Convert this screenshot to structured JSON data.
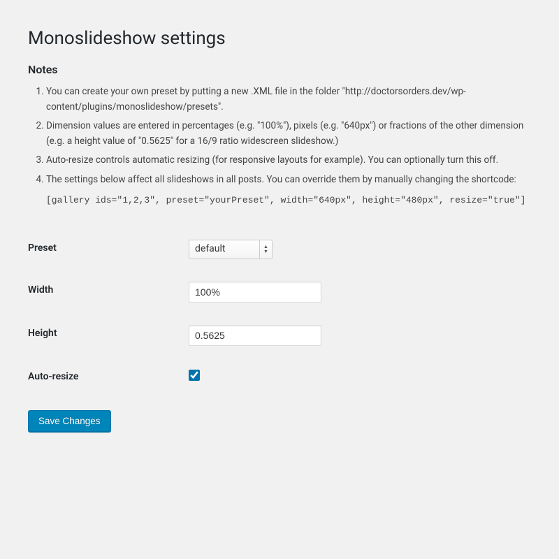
{
  "page": {
    "title": "Monoslideshow settings",
    "notes_heading": "Notes",
    "notes": [
      "You can create your own preset by putting a new .XML file in the folder \"http://doctorsorders.dev/wp-content/plugins/monoslideshow/presets\".",
      "Dimension values are entered in percentages (e.g. \"100%\"), pixels (e.g. \"640px\") or fractions of the other dimension (e.g. a height value of \"0.5625\" for a 16/9 ratio widescreen slideshow.)",
      "Auto-resize controls automatic resizing (for responsive layouts for example). You can optionally turn this off.",
      "The settings below affect all slideshows in all posts. You can override them by manually changing the shortcode:"
    ],
    "code_example": "[gallery ids=\"1,2,3\", preset=\"yourPreset\", width=\"640px\", height=\"480px\", resize=\"true\"]"
  },
  "form": {
    "preset": {
      "label": "Preset",
      "value": "default"
    },
    "width": {
      "label": "Width",
      "value": "100%"
    },
    "height": {
      "label": "Height",
      "value": "0.5625"
    },
    "autoresize": {
      "label": "Auto-resize",
      "checked": true
    },
    "submit_label": "Save Changes"
  }
}
